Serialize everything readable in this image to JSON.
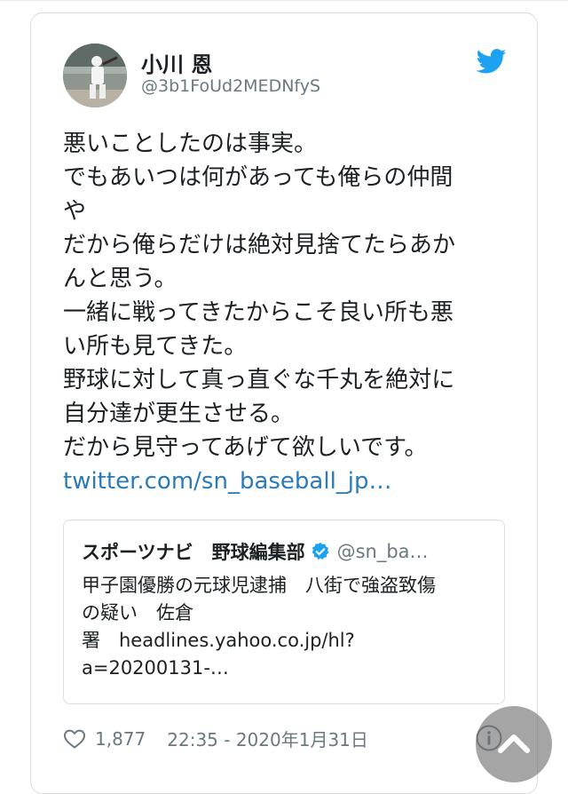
{
  "tweet": {
    "display_name": "小川 恩",
    "handle": "@3b1FoUd2MEDNfyS",
    "lines": [
      "悪いことしたのは事実。",
      "でもあいつは何があっても俺らの仲間",
      "や",
      "だから俺らだけは絶対見捨てたらあか",
      "んと思う。",
      "一緒に戦ってきたからこそ良い所も悪",
      "い所も見てきた。",
      "野球に対して真っ直ぐな千丸を絶対に",
      "自分達が更生させる。",
      "だから見守ってあげて欲しいです。"
    ],
    "link": "twitter.com/sn_baseball_jp…"
  },
  "quote": {
    "name": "スポーツナビ　野球編集部",
    "handle": "@sn_ba…",
    "lines": [
      "甲子園優勝の元球児逮捕　八街で強盗致傷",
      "の疑い　佐倉",
      "署　headlines.yahoo.co.jp/hl?",
      "a=20200131-…"
    ]
  },
  "footer": {
    "like_count": "1,877",
    "timestamp": "22:35 - 2020年1月31日"
  },
  "icons": {
    "brand": "twitter-bird-icon",
    "verified": "verified-badge-icon",
    "like": "heart-icon",
    "info": "info-icon",
    "scroll": "chevron-up-icon"
  },
  "colors": {
    "twitter_blue": "#1da1f2",
    "link": "#2b7bb9",
    "muted": "#697882",
    "text": "#1c2022"
  }
}
